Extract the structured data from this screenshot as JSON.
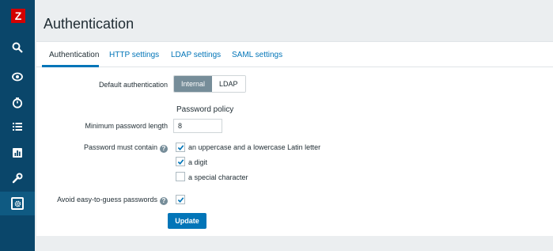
{
  "logo": {
    "letter": "Z",
    "color": "#d40000"
  },
  "sidebar": {
    "items": [
      {
        "icon": "search-icon"
      },
      {
        "icon": "eye-icon"
      },
      {
        "icon": "clock-icon"
      },
      {
        "icon": "list-icon"
      },
      {
        "icon": "chart-icon"
      },
      {
        "icon": "wrench-icon"
      },
      {
        "icon": "gear-icon",
        "active": true
      }
    ]
  },
  "page": {
    "title": "Authentication"
  },
  "tabs": [
    {
      "label": "Authentication",
      "active": true
    },
    {
      "label": "HTTP settings"
    },
    {
      "label": "LDAP settings"
    },
    {
      "label": "SAML settings"
    }
  ],
  "form": {
    "default_auth_label": "Default authentication",
    "default_auth_options": [
      "Internal",
      "LDAP"
    ],
    "default_auth_selected": "Internal",
    "password_policy_heading": "Password policy",
    "min_length_label": "Minimum password length",
    "min_length_value": "8",
    "must_contain_label": "Password must contain",
    "must_contain_options": [
      {
        "label": "an uppercase and a lowercase Latin letter",
        "checked": true
      },
      {
        "label": "a digit",
        "checked": true
      },
      {
        "label": "a special character",
        "checked": false
      }
    ],
    "avoid_easy_label": "Avoid easy-to-guess passwords",
    "avoid_easy_checked": true,
    "update_label": "Update"
  },
  "colors": {
    "sidebar": "#0a466a",
    "accent": "#0275b8",
    "selected_segment": "#768d99",
    "background": "#ebeef0"
  }
}
